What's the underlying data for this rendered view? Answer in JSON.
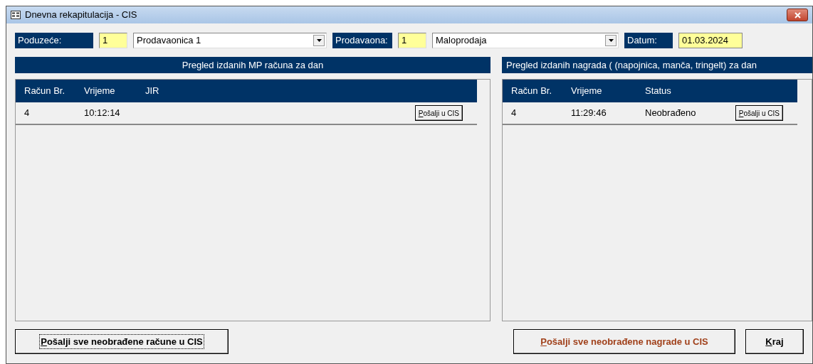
{
  "window": {
    "title": "Dnevna rekapitulacija - CIS"
  },
  "filters": [
    {
      "kind": "combo",
      "label": "Poduzeće:",
      "code": "1",
      "value": "Prodavaonica 1"
    },
    {
      "kind": "combo",
      "label": "Prodavaona:",
      "code": "1",
      "value": "Maloprodaja"
    },
    {
      "kind": "date",
      "label": "Datum:",
      "value": "01.03.2024"
    }
  ],
  "receipts_panel": {
    "title": "Pregled izdanih MP računa za dan",
    "columns": [
      "Račun Br.",
      "Vrijeme",
      "JIR"
    ],
    "rows": [
      {
        "cells": [
          "4",
          "10:12:14",
          ""
        ],
        "button": "Pošalji u CIS"
      }
    ]
  },
  "rewards_panel": {
    "title": "Pregled izdanih nagrada ( (napojnica, manča, tringelt) za dan",
    "columns": [
      "Račun Br.",
      "Vrijeme",
      "Status"
    ],
    "rows": [
      {
        "cells": [
          "4",
          "11:29:46",
          "Neobrađeno"
        ],
        "button": "Pošalji u CIS"
      }
    ]
  },
  "buttons": [
    {
      "label": "Pošalji sve neobrađene račune u CIS",
      "focused": true,
      "color": "#000000"
    },
    {
      "label": "Pošalji sve neobrađene nagrade u CIS",
      "focused": false,
      "color": "#a0401a"
    },
    {
      "label": "Kraj",
      "focused": false,
      "color": "#000000"
    }
  ]
}
